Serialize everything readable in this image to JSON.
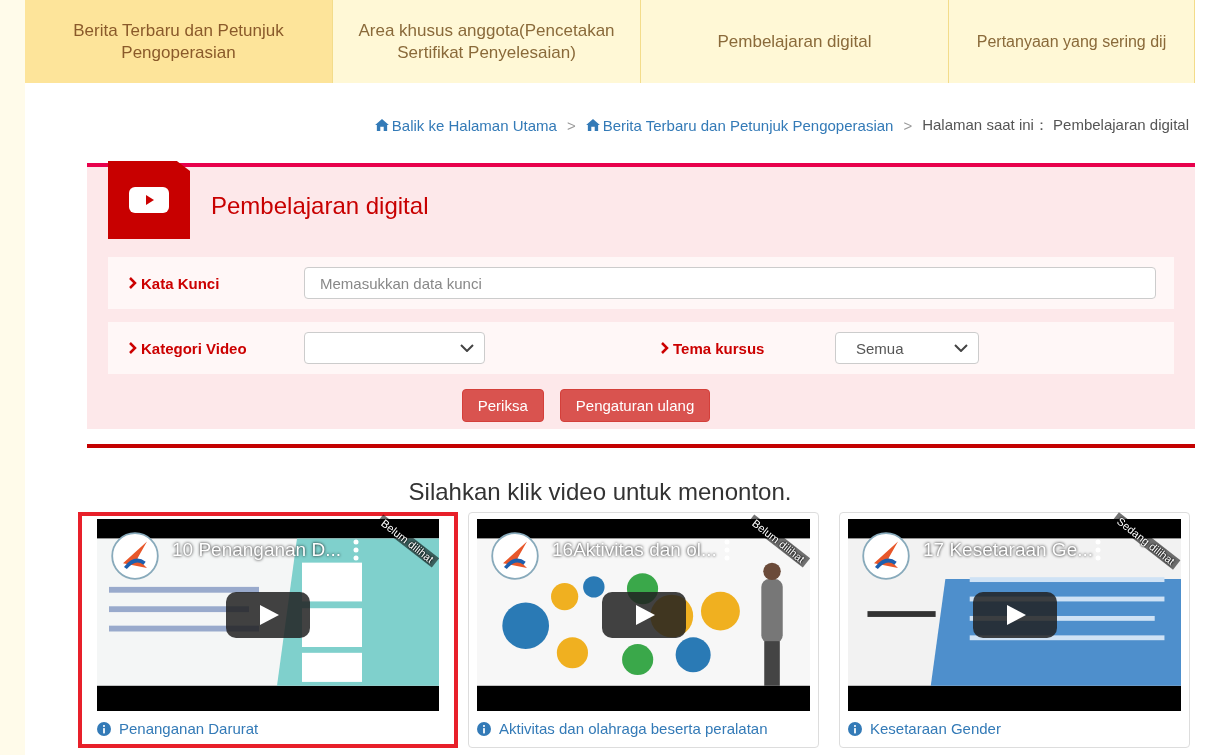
{
  "nav_tabs": [
    {
      "label": "Berita Terbaru dan Petunjuk Pengoperasian",
      "selected": true
    },
    {
      "label": "Area khusus anggota(Pencetakan Sertifikat Penyelesaian)",
      "selected": false
    },
    {
      "label": "Pembelajaran digital",
      "selected": false
    },
    {
      "label": "Pertanyaan yang sering dij",
      "selected": false
    }
  ],
  "breadcrumb": {
    "links": [
      "Balik ke Halaman Utama",
      "Berita Terbaru dan Petunjuk Pengoperasian"
    ],
    "separator": ">",
    "current": "Halaman saat ini： Pembelajaran digital"
  },
  "panel": {
    "title": "Pembelajaran digital",
    "keyword": {
      "label": "Kata Kunci",
      "placeholder": "Memasukkan data kunci"
    },
    "category": {
      "label": "Kategori Video"
    },
    "theme": {
      "label": "Tema kursus",
      "value": "Semua"
    },
    "buttons": [
      "Periksa",
      "Pengaturan ulang"
    ]
  },
  "heading": "Silahkan klik video untuk menonton.",
  "videos": [
    {
      "overlay_title": "10 Penanganan D...",
      "status": "Belum dilihat",
      "caption": "Penanganan Darurat",
      "selected": true
    },
    {
      "overlay_title": "16Aktivitas dan ol...",
      "status": "Belum dilihat",
      "caption": "Aktivitas dan olahraga beserta peralatan",
      "selected": false
    },
    {
      "overlay_title": "17 Kesetaraan Ge...",
      "status": "Sedang dilihat",
      "caption": "Kesetaraan Gender",
      "selected": false
    }
  ]
}
